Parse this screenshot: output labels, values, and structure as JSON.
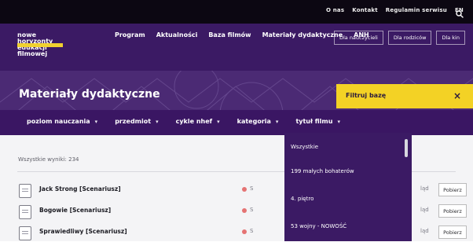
{
  "topbar": {
    "links": [
      "O nas",
      "Kontakt",
      "Regulamin serwisu",
      "EN"
    ]
  },
  "logo": {
    "lines": [
      "nowe",
      "horyzonty",
      "edukacji",
      "filmowej"
    ]
  },
  "nav": {
    "items": [
      "Program",
      "Aktualności",
      "Baza filmów",
      "Materiały dydaktyczne",
      "ANH"
    ],
    "buttons": [
      "Dla nauczycieli",
      "Dla rodziców",
      "Dla kin"
    ]
  },
  "hero": {
    "title": "Materiały dydaktyczne",
    "filter": {
      "label": "Filtruj bazę",
      "close": "×"
    }
  },
  "filters": [
    "poziom nauczania",
    "przedmiot",
    "cykle nhef",
    "kategoria",
    "tytuł filmu"
  ],
  "results": {
    "count_text": "Wszystkie wyniki: 234",
    "rows": [
      {
        "title": "Jack Strong [Scenariusz]",
        "tag": "S",
        "seen": "ląd",
        "action": "Pobierz"
      },
      {
        "title": "Bogowie [Scenariusz]",
        "tag": "S",
        "seen": "ląd",
        "action": "Pobierz"
      },
      {
        "title": "Sprawiedliwy [Scenariusz]",
        "tag": "S",
        "seen": "ląd",
        "action": "Pobierz"
      }
    ]
  },
  "dropdown": {
    "items": [
      "Wszystkie",
      "199 małych bohaterów",
      "4. piętro",
      "53 wojny - NOWOŚĆ"
    ]
  }
}
